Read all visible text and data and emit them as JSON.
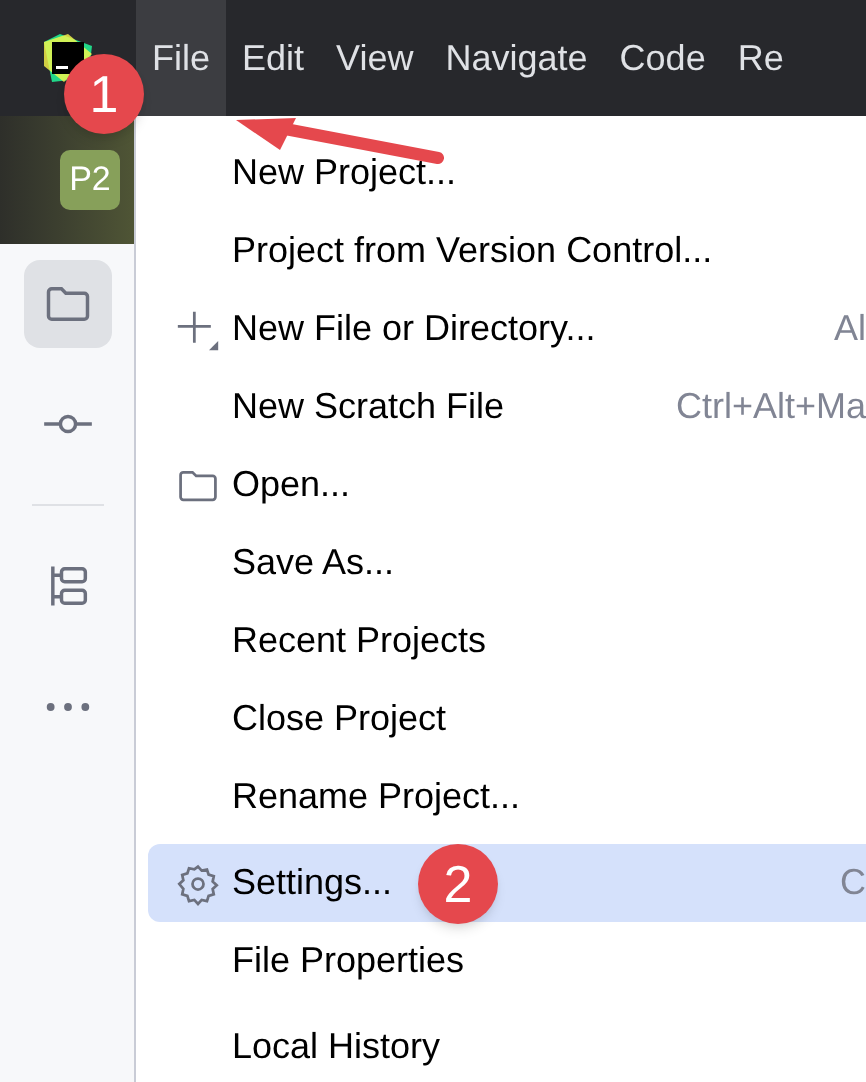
{
  "menu_bar": [
    {
      "label": "File",
      "selected": true
    },
    {
      "label": "Edit",
      "selected": false
    },
    {
      "label": "View",
      "selected": false
    },
    {
      "label": "Navigate",
      "selected": false
    },
    {
      "label": "Code",
      "selected": false
    },
    {
      "label": "Re",
      "selected": false
    }
  ],
  "project_badge": "P2",
  "sidebar": {
    "items": [
      {
        "kind": "folder",
        "selected": true
      },
      {
        "kind": "commit",
        "selected": false
      },
      {
        "kind": "separator"
      },
      {
        "kind": "structure",
        "selected": false
      },
      {
        "kind": "more",
        "selected": false
      }
    ]
  },
  "file_menu": {
    "items": [
      {
        "kind": "plain",
        "label": "New Project...",
        "selected": false
      },
      {
        "kind": "plain",
        "label": "Project from Version Control...",
        "selected": false
      },
      {
        "kind": "plus",
        "label": "New File or Directory...",
        "shortcut": "Al",
        "selected": false
      },
      {
        "kind": "plain",
        "label": "New Scratch File",
        "shortcut": "Ctrl+Alt+Ma",
        "selected": false
      },
      {
        "kind": "folder",
        "label": "Open...",
        "selected": false
      },
      {
        "kind": "plain",
        "label": "Save As...",
        "selected": false
      },
      {
        "kind": "plain",
        "label": "Recent Projects",
        "selected": false
      },
      {
        "kind": "plain",
        "label": "Close Project",
        "selected": false
      },
      {
        "kind": "plain",
        "label": "Rename Project...",
        "selected": false
      },
      {
        "kind": "separator"
      },
      {
        "kind": "gear",
        "label": "Settings...",
        "shortcut": "C",
        "selected": true
      },
      {
        "kind": "plain",
        "label": "File Properties",
        "selected": false
      },
      {
        "kind": "separator"
      },
      {
        "kind": "plain",
        "label": "Local History",
        "selected": false
      }
    ]
  },
  "annotations": [
    {
      "label": "1"
    },
    {
      "label": "2"
    }
  ]
}
